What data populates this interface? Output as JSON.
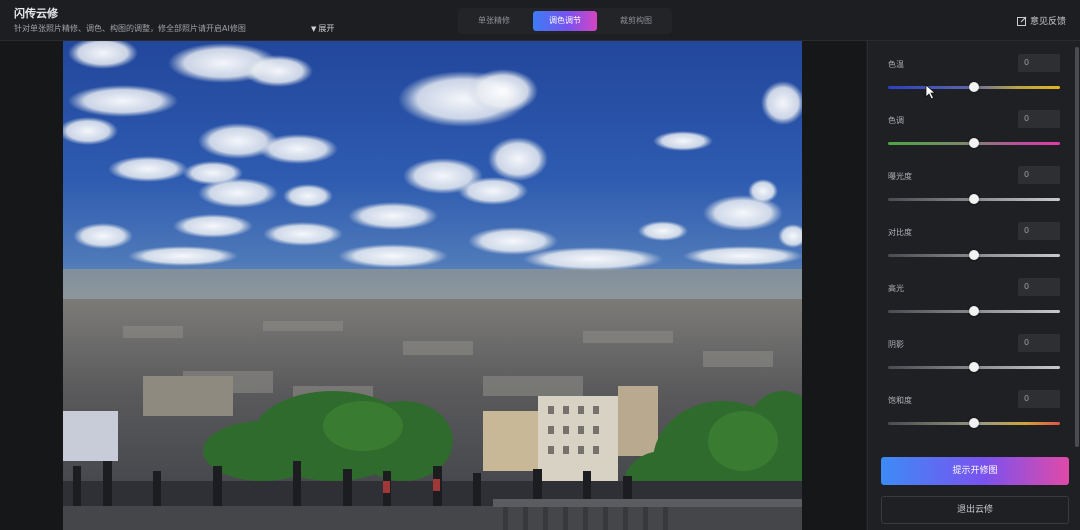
{
  "header": {
    "title": "闪传云修",
    "description": "针对单张照片精修、调色、构图的调整，修全部照片请开启AI修图",
    "expand_label": "展开",
    "tabs": [
      {
        "label": "单张精修",
        "active": false
      },
      {
        "label": "调色调节",
        "active": true
      },
      {
        "label": "裁剪构图",
        "active": false
      }
    ],
    "feedback_label": "意见反馈"
  },
  "adjustments": [
    {
      "label": "色温",
      "value": "0",
      "position": 0.5
    },
    {
      "label": "色调",
      "value": "0",
      "position": 0.5
    },
    {
      "label": "曝光度",
      "value": "0",
      "position": 0.5
    },
    {
      "label": "对比度",
      "value": "0",
      "position": 0.5
    },
    {
      "label": "高光",
      "value": "0",
      "position": 0.5
    },
    {
      "label": "阴影",
      "value": "0",
      "position": 0.5
    },
    {
      "label": "饱和度",
      "value": "0",
      "position": 0.5
    }
  ],
  "actions": {
    "primary_label": "提示开修图",
    "secondary_label": "退出云修"
  },
  "colors": {
    "accent_start": "#3d7cf6",
    "accent_mid": "#7a52ee",
    "accent_end": "#d645c2"
  }
}
